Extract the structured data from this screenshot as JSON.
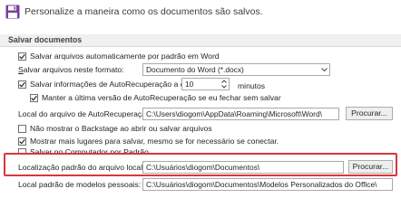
{
  "header": {
    "title": "Personalize a maneira como os documentos são salvos."
  },
  "section": {
    "title": "Salvar documentos"
  },
  "autosave_onedrive": {
    "label": "Salvar arquivos automaticamente por padrão em Word",
    "checked": true
  },
  "save_format": {
    "label": "Salvar arquivos neste formato:",
    "value": "Documento do Word (*.docx)"
  },
  "autorecover": {
    "label": "Salvar informações de AutoRecuperação a cada",
    "value": "10",
    "unit": "minutos",
    "checked": true
  },
  "keep_last_version": {
    "label": "Manter a última versão de AutoRecuperação se eu fechar sem salvar",
    "checked": true
  },
  "autorecover_location": {
    "label": "Local do arquivo de AutoRecuperação:",
    "value": "C:\\Users\\diogom\\AppData\\Roaming\\Microsoft\\Word\\",
    "browse_label": "Procurar..."
  },
  "no_backstage": {
    "label": "Não mostrar o Backstage ao abrir ou salvar arquivos",
    "checked": false
  },
  "show_more_places": {
    "label": "Mostrar mais lugares para salvar, mesmo se for necessário se conectar.",
    "checked": true
  },
  "save_to_computer": {
    "label": "Salvar no Computador por Padrão",
    "checked": false
  },
  "default_location": {
    "label": "Localização padrão do arquivo local:",
    "value": "C:\\Usuários\\diogom\\Documentos\\",
    "browse_label": "Procurar..."
  },
  "templates_location": {
    "label": "Local padrão de modelos pessoais:",
    "value": "C:\\Usuários\\diogom\\Documentos\\Modelos Personalizados do Office\\"
  },
  "colors": {
    "highlight": "#d9373b",
    "icon": "#7a3f9d"
  }
}
